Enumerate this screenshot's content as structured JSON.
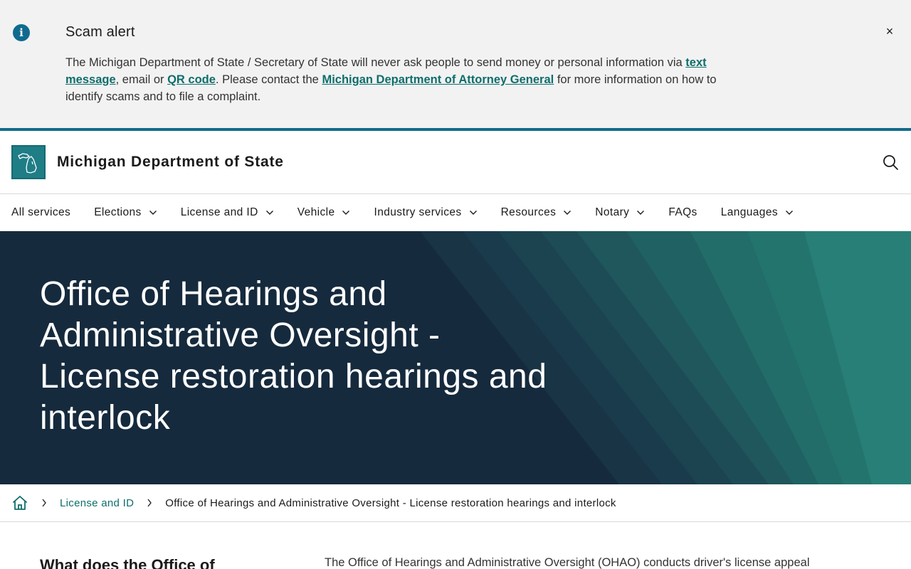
{
  "alert": {
    "icon": "info-icon",
    "title": "Scam alert",
    "body_part1": "The Michigan Department of State / Secretary of State will never ask people to send money or personal information via ",
    "link_text_message": "text message",
    "body_part2": ", email or ",
    "link_qr_code": "QR code",
    "body_part3": ". Please contact the ",
    "link_attorney_general": "Michigan Department of Attorney General",
    "body_part4": " for more information on how to identify scams and to file a complaint.",
    "close_label": "×",
    "close_icon": "close-icon"
  },
  "header": {
    "title": "Michigan Department of State",
    "logo_icon": "michigan-map-logo",
    "search_icon": "search-icon"
  },
  "nav": {
    "items": [
      {
        "label": "All services",
        "has_dropdown": false
      },
      {
        "label": "Elections",
        "has_dropdown": true
      },
      {
        "label": "License and ID",
        "has_dropdown": true
      },
      {
        "label": "Vehicle",
        "has_dropdown": true
      },
      {
        "label": "Industry services",
        "has_dropdown": true
      },
      {
        "label": "Resources",
        "has_dropdown": true
      },
      {
        "label": "Notary",
        "has_dropdown": true
      },
      {
        "label": "FAQs",
        "has_dropdown": false
      },
      {
        "label": "Languages",
        "has_dropdown": true
      }
    ]
  },
  "hero": {
    "title": "Office of Hearings and Administrative Oversight - License restoration hearings and interlock"
  },
  "breadcrumb": {
    "home_icon": "home-icon",
    "link": "License and ID",
    "current": "Office of Hearings and Administrative Oversight - License restoration hearings and interlock"
  },
  "content": {
    "heading": "What does the Office of",
    "text": "The Office of Hearings and Administrative Oversight (OHAO) conducts driver's license appeal"
  },
  "colors": {
    "accent_teal": "#0e6e6b",
    "header_border": "#0f6b8a",
    "hero_bg": "#162a3d",
    "alert_bg": "#f2f2f2"
  }
}
